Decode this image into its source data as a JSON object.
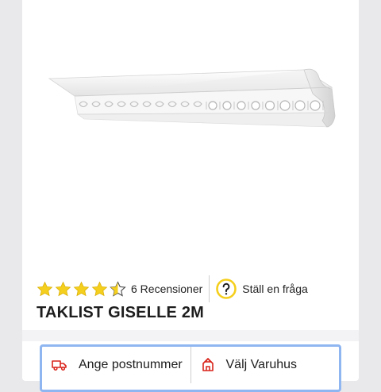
{
  "product": {
    "title": "TAKLIST GISELLE 2M",
    "rating": 4.5,
    "rating_max": 5,
    "review_count_label": "6 Recensioner",
    "ask_question_label": "Ställ en fråga"
  },
  "delivery": {
    "postcode_label": "Ange postnummer",
    "store_label": "Välj Varuhus"
  },
  "colors": {
    "star": "#f5cf1d",
    "question_icon": "#f5cf1d",
    "delivery_icon": "#d9241b",
    "focus_border": "#8fb6f0"
  },
  "icons": {
    "truck": "truck-icon",
    "store": "store-icon",
    "question": "question-icon"
  }
}
